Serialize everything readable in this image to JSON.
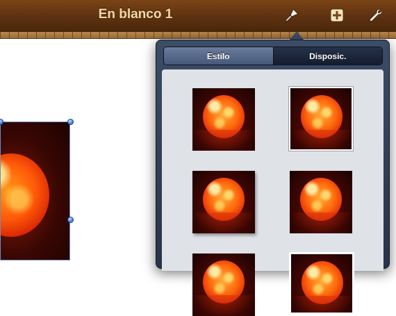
{
  "toolbar": {
    "title": "En blanco 1",
    "icons": [
      "paintbrush-icon",
      "add-icon",
      "wrench-icon"
    ]
  },
  "popover": {
    "tabs": [
      {
        "label": "Estilo",
        "active": true
      },
      {
        "label": "Disposic.",
        "active": false
      }
    ],
    "styles": [
      {
        "name": "plain"
      },
      {
        "name": "thin-frame"
      },
      {
        "name": "shadow"
      },
      {
        "name": "plain-2"
      },
      {
        "name": "plain-3"
      },
      {
        "name": "white-border"
      }
    ]
  },
  "colors": {
    "toolbar": "#5c3110",
    "title": "#f3d9a8",
    "popover": "#2f3d55",
    "selection": "#3f7fd3"
  }
}
